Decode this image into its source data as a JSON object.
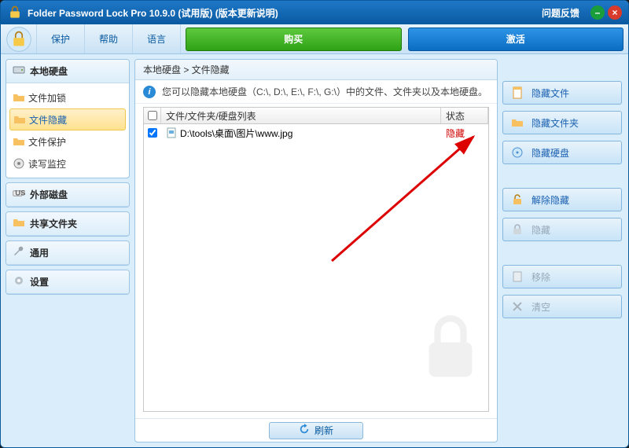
{
  "title": "Folder Password Lock Pro 10.9.0 (试用版) (版本更新说明)",
  "feedback": "问题反馈",
  "menus": {
    "protect": "保护",
    "help": "帮助",
    "language": "语言"
  },
  "bigbtns": {
    "buy": "购买",
    "activate": "激活"
  },
  "sidebar": {
    "local": {
      "title": "本地硬盘",
      "items": [
        "文件加锁",
        "文件隐藏",
        "文件保护",
        "读写监控"
      ],
      "active_index": 1
    },
    "external": {
      "title": "外部磁盘"
    },
    "share": {
      "title": "共享文件夹"
    },
    "general": {
      "title": "通用"
    },
    "settings": {
      "title": "设置"
    }
  },
  "breadcrumb": "本地硬盘 > 文件隐藏",
  "info": "您可以隐藏本地硬盘（C:\\, D:\\, E:\\, F:\\, G:\\）中的文件、文件夹以及本地硬盘。",
  "table": {
    "headers": {
      "path": "文件/文件夹/硬盘列表",
      "status": "状态"
    },
    "rows": [
      {
        "checked": true,
        "path": "D:\\tools\\桌面\\图片\\www.jpg",
        "status": "隐藏"
      }
    ]
  },
  "refresh": "刷新",
  "actions": {
    "hide_file": "隐藏文件",
    "hide_folder": "隐藏文件夹",
    "hide_disk": "隐藏硬盘",
    "unhide": "解除隐藏",
    "hide": "隐藏",
    "remove": "移除",
    "clear": "清空"
  }
}
